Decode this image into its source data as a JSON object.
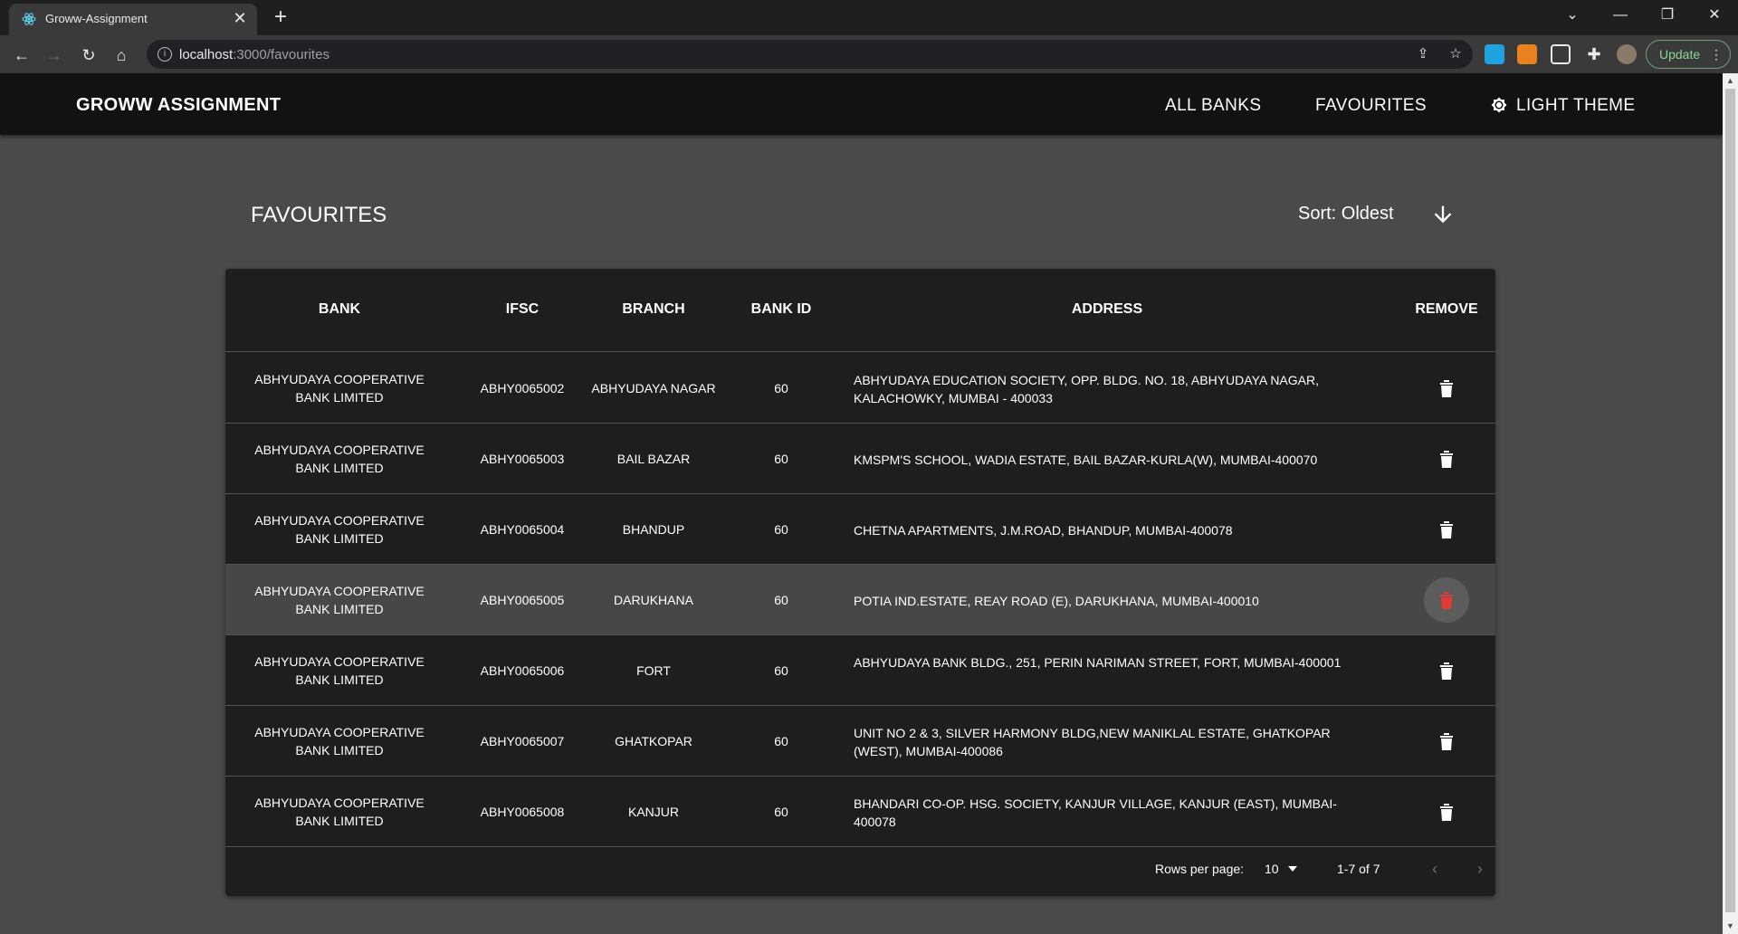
{
  "browser": {
    "tab_title": "Groww-Assignment",
    "tab_close": "✕",
    "new_tab": "+",
    "url_host": "localhost",
    "url_path": ":3000/favourites",
    "update_label": "Update"
  },
  "header": {
    "brand": "GROWW ASSIGNMENT",
    "nav_all_banks": "ALL BANKS",
    "nav_favourites": "FAVOURITES",
    "theme_toggle": "LIGHT THEME"
  },
  "page": {
    "title": "FAVOURITES",
    "sort_label": "Sort: Oldest"
  },
  "table": {
    "columns": [
      "BANK",
      "IFSC",
      "BRANCH",
      "BANK ID",
      "ADDRESS",
      "REMOVE"
    ],
    "rows": [
      {
        "bank_line1": "ABHYUDAYA COOPERATIVE",
        "bank_line2": "BANK LIMITED",
        "ifsc": "ABHY0065002",
        "branch": "ABHYUDAYA NAGAR",
        "bank_id": "60",
        "address": "ABHYUDAYA EDUCATION SOCIETY, OPP. BLDG. NO. 18, ABHYUDAYA NAGAR, KALACHOWKY, MUMBAI - 400033"
      },
      {
        "bank_line1": "ABHYUDAYA COOPERATIVE",
        "bank_line2": "BANK LIMITED",
        "ifsc": "ABHY0065003",
        "branch": "BAIL BAZAR",
        "bank_id": "60",
        "address": "KMSPM'S SCHOOL, WADIA ESTATE, BAIL BAZAR-KURLA(W), MUMBAI-400070"
      },
      {
        "bank_line1": "ABHYUDAYA COOPERATIVE",
        "bank_line2": "BANK LIMITED",
        "ifsc": "ABHY0065004",
        "branch": "BHANDUP",
        "bank_id": "60",
        "address": "CHETNA APARTMENTS, J.M.ROAD, BHANDUP, MUMBAI-400078"
      },
      {
        "bank_line1": "ABHYUDAYA COOPERATIVE",
        "bank_line2": "BANK LIMITED",
        "ifsc": "ABHY0065005",
        "branch": "DARUKHANA",
        "bank_id": "60",
        "address": "POTIA IND.ESTATE, REAY ROAD (E), DARUKHANA, MUMBAI-400010"
      },
      {
        "bank_line1": "ABHYUDAYA COOPERATIVE",
        "bank_line2": "BANK LIMITED",
        "ifsc": "ABHY0065006",
        "branch": "FORT",
        "bank_id": "60",
        "address": "ABHYUDAYA BANK BLDG., 251, PERIN NARIMAN STREET, FORT, MUMBAI-400001"
      },
      {
        "bank_line1": "ABHYUDAYA COOPERATIVE",
        "bank_line2": "BANK LIMITED",
        "ifsc": "ABHY0065007",
        "branch": "GHATKOPAR",
        "bank_id": "60",
        "address": "UNIT NO 2 & 3, SILVER HARMONY BLDG,NEW MANIKLAL ESTATE, GHATKOPAR (WEST), MUMBAI-400086"
      },
      {
        "bank_line1": "ABHYUDAYA COOPERATIVE",
        "bank_line2": "BANK LIMITED",
        "ifsc": "ABHY0065008",
        "branch": "KANJUR",
        "bank_id": "60",
        "address": "BHANDARI CO-OP. HSG. SOCIETY, KANJUR VILLAGE, KANJUR (EAST), MUMBAI-400078"
      }
    ],
    "footer": {
      "rows_per_page_label": "Rows per page:",
      "rows_per_page_value": "10",
      "range": "1-7 of 7",
      "prev": "‹",
      "next": "›"
    }
  },
  "colors": {
    "page_bg": "#4a4a4a",
    "appbar_bg": "#121212",
    "table_bg": "#1e1e1e",
    "delete_hover": "#e53935"
  }
}
